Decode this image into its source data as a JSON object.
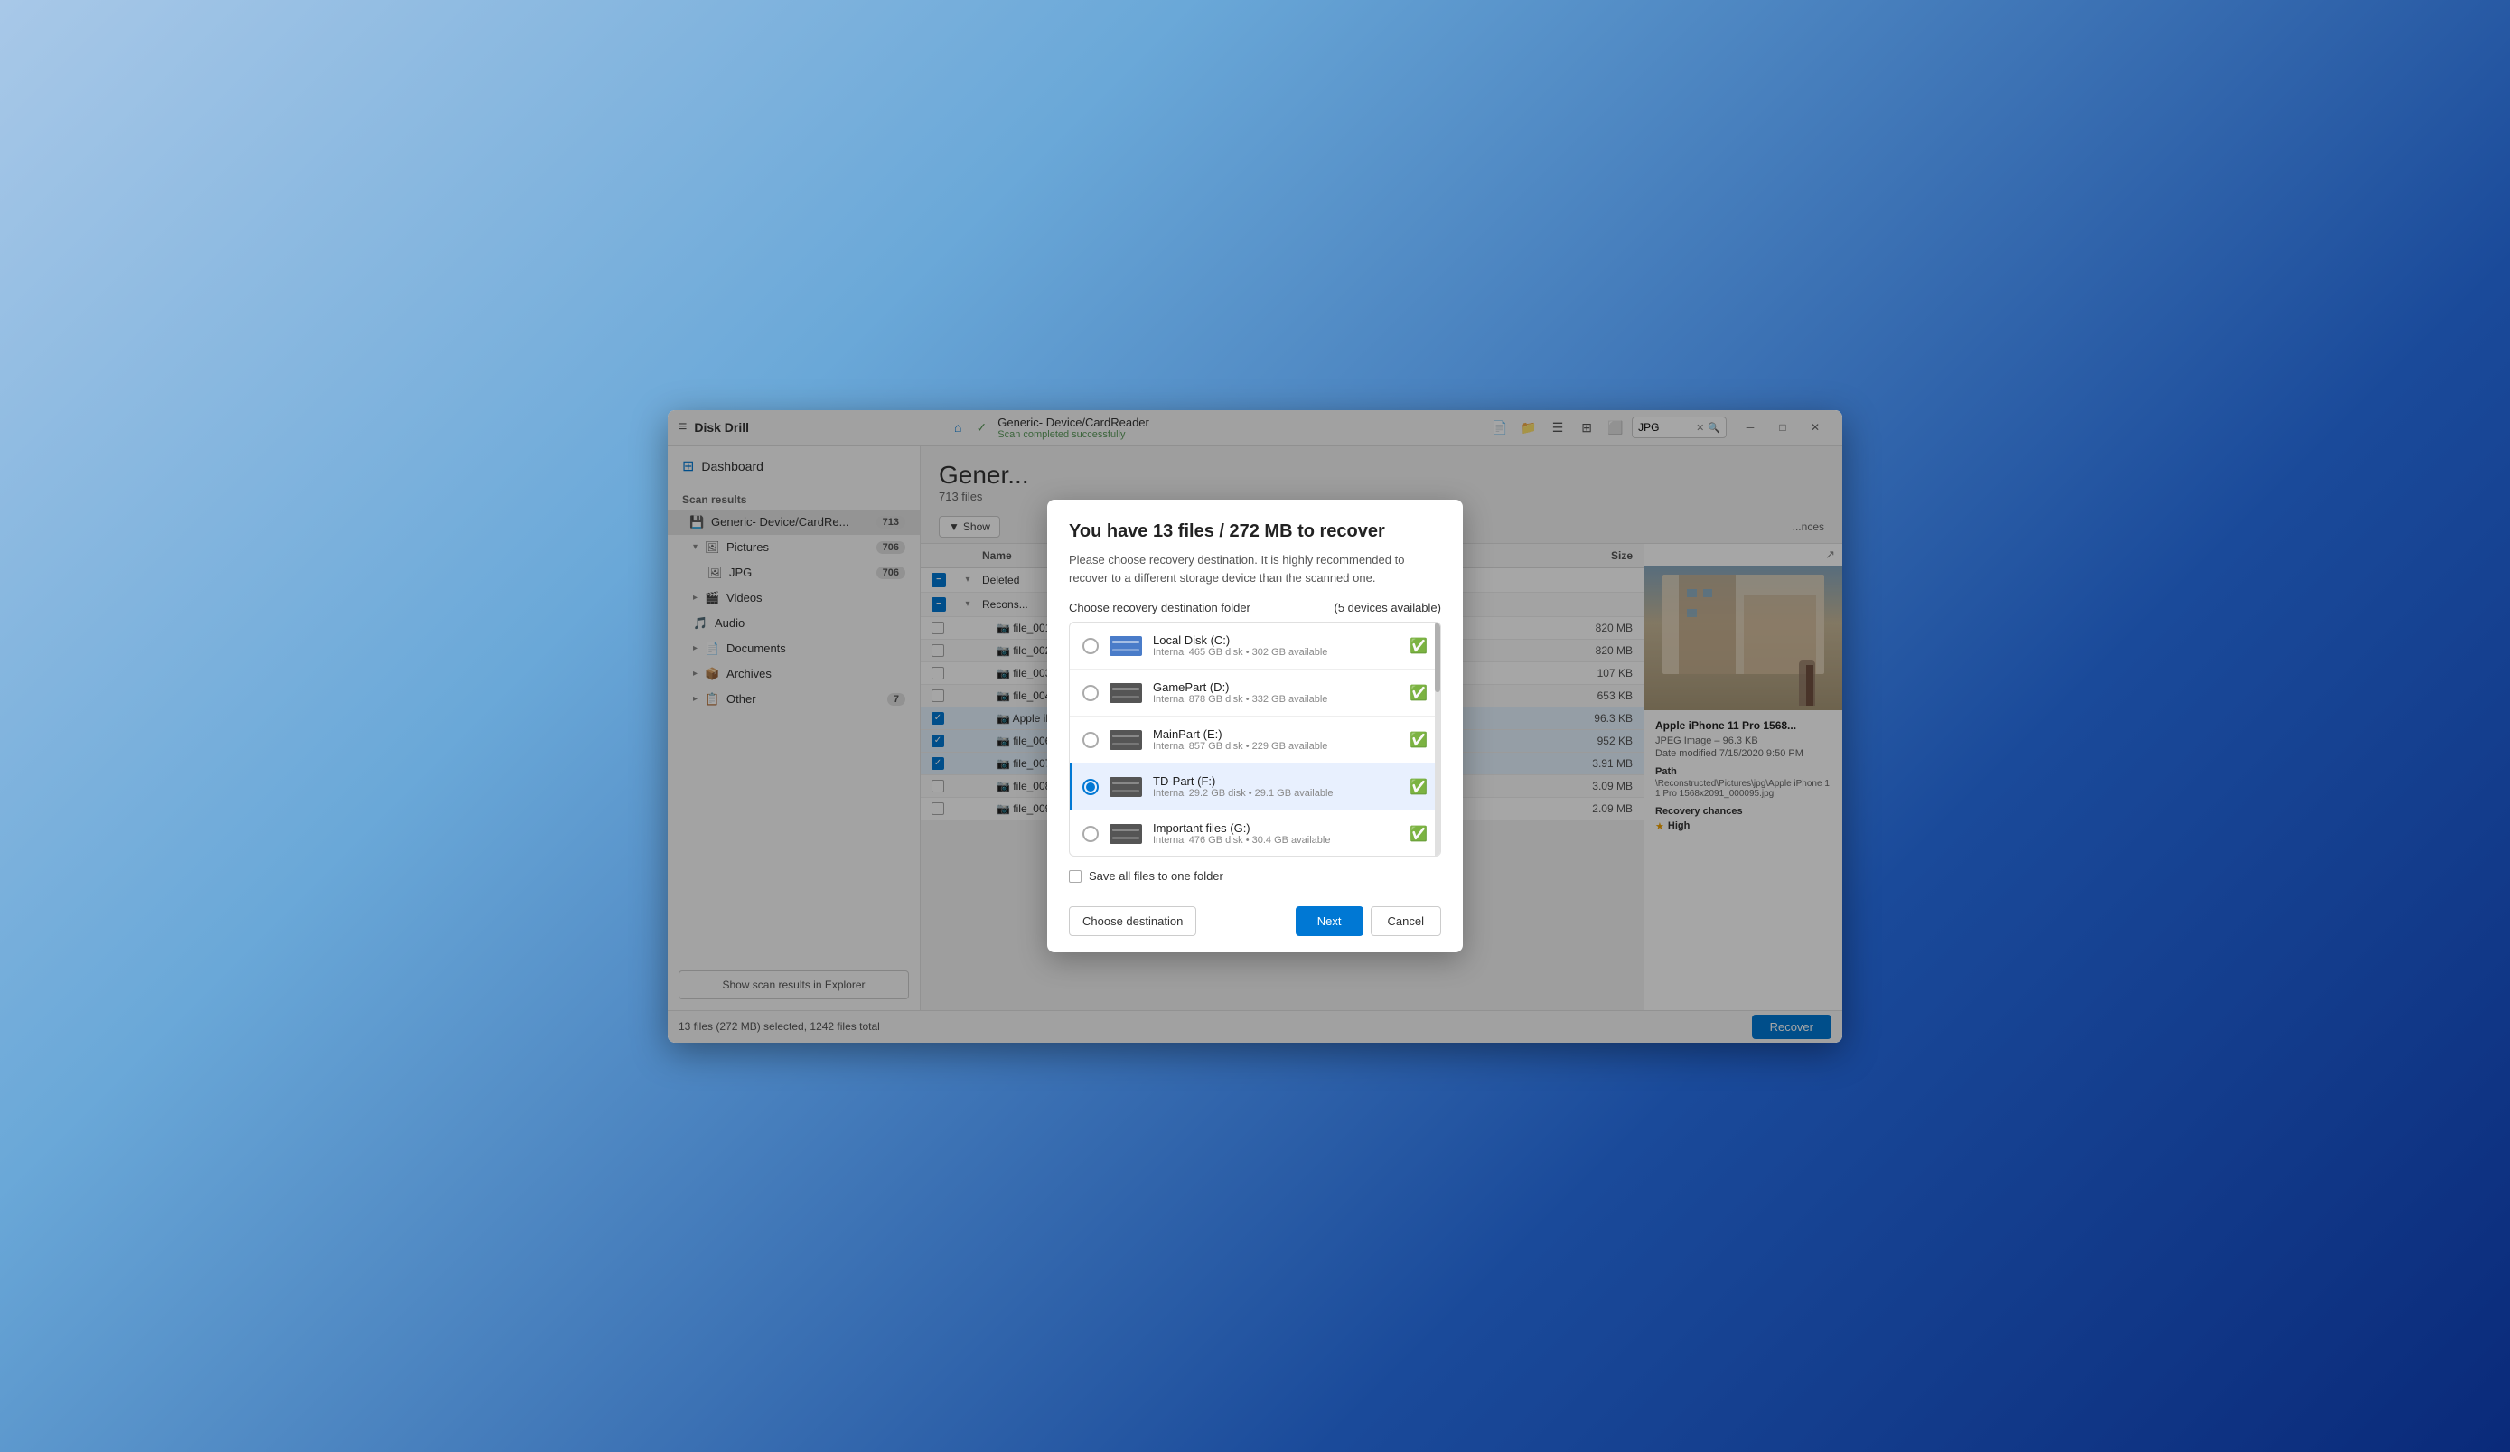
{
  "app": {
    "title": "Disk Drill",
    "hamburger": "≡"
  },
  "titlebar": {
    "device_name": "Generic- Device/CardReader",
    "device_status": "Scan completed successfully",
    "search_placeholder": "JPG",
    "minimize": "─",
    "maximize": "□",
    "close": "✕"
  },
  "sidebar": {
    "dashboard_label": "Dashboard",
    "scan_results_label": "Scan results",
    "device_item_label": "Generic- Device/CardRe...",
    "device_badge": "713",
    "pictures_label": "Pictures",
    "pictures_badge": "706",
    "jpg_label": "JPG",
    "jpg_badge": "706",
    "videos_label": "Videos",
    "audio_label": "Audio",
    "documents_label": "Documents",
    "archives_label": "Archives",
    "other_label": "Other",
    "other_badge": "7",
    "show_explorer_btn": "Show scan results in Explorer"
  },
  "content": {
    "title": "Gener...",
    "subtitle": "713 files",
    "show_btn": "Show",
    "table_headers": {
      "name": "Name",
      "size": "Size"
    },
    "file_rows": [
      {
        "name": "Deleted",
        "size": "",
        "checked": false,
        "expanded": true,
        "indent": 1
      },
      {
        "name": "Recons",
        "size": "",
        "checked": false,
        "expanded": true,
        "indent": 1
      },
      {
        "name": "",
        "size": "820 MB",
        "checked": false,
        "indent": 2
      },
      {
        "name": "",
        "size": "820 MB",
        "checked": false,
        "indent": 2
      },
      {
        "name": "",
        "size": "107 KB",
        "checked": false,
        "indent": 2
      },
      {
        "name": "",
        "size": "653 KB",
        "checked": false,
        "indent": 2
      },
      {
        "name": "",
        "size": "96.3 KB",
        "checked": true,
        "indent": 2
      },
      {
        "name": "",
        "size": "952 KB",
        "checked": true,
        "indent": 2
      },
      {
        "name": "",
        "size": "3.91 MB",
        "checked": true,
        "indent": 2
      },
      {
        "name": "",
        "size": "3.09 MB",
        "checked": false,
        "indent": 2
      },
      {
        "name": "",
        "size": "2.09 MB",
        "checked": false,
        "indent": 2
      }
    ]
  },
  "preview": {
    "filename": "Apple iPhone 11 Pro 1568...",
    "type": "JPEG Image",
    "size": "96.3 KB",
    "date_modified": "Date modified 7/15/2020 9:50 PM",
    "path_label": "Path",
    "path_value": "\\Reconstructed\\Pictures\\jpg\\Apple iPhone 11 Pro 1568x2091_000095.jpg",
    "recovery_chances_label": "Recovery chances",
    "recovery_level": "High"
  },
  "status_bar": {
    "text": "13 files (272 MB) selected, 1242 files total",
    "recover_btn": "Recover"
  },
  "modal": {
    "title": "You have 13 files / 272 MB to recover",
    "description": "Please choose recovery destination. It is highly recommended to recover to a different storage device than the scanned one.",
    "section_title": "Choose recovery destination folder",
    "devices_count": "(5 devices available)",
    "devices": [
      {
        "name": "Local Disk (C:)",
        "meta": "Internal 465 GB disk • 302 GB available",
        "selected": false,
        "ok": true,
        "icon_color": "blue"
      },
      {
        "name": "GamePart (D:)",
        "meta": "Internal 878 GB disk • 332 GB available",
        "selected": false,
        "ok": true,
        "icon_color": "dark"
      },
      {
        "name": "MainPart (E:)",
        "meta": "Internal 857 GB disk • 229 GB available",
        "selected": false,
        "ok": true,
        "icon_color": "dark"
      },
      {
        "name": "TD-Part (F:)",
        "meta": "Internal 29.2 GB disk • 29.1 GB available",
        "selected": true,
        "ok": true,
        "icon_color": "dark"
      },
      {
        "name": "Important files (G:)",
        "meta": "Internal 476 GB disk • 30.4 GB available",
        "selected": false,
        "ok": true,
        "icon_color": "dark"
      }
    ],
    "save_one_folder_label": "Save all files to one folder",
    "save_one_folder_checked": false,
    "choose_dest_btn": "Choose destination",
    "next_btn": "Next",
    "cancel_btn": "Cancel"
  }
}
